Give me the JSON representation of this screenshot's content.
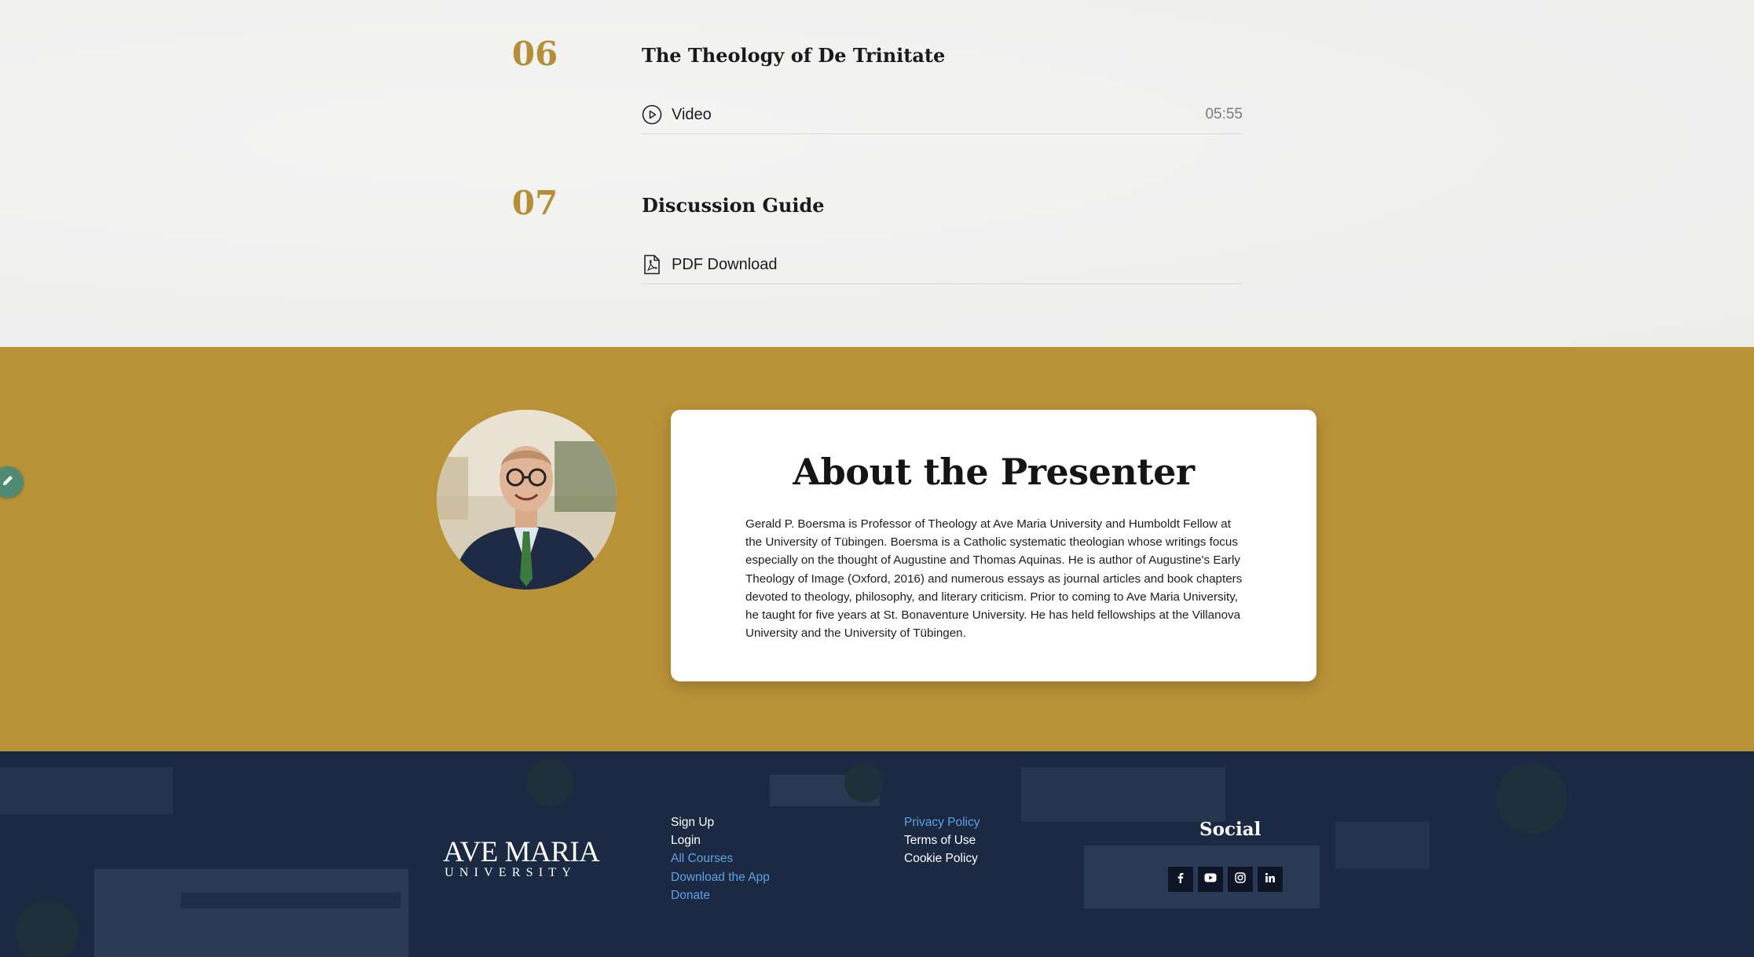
{
  "lessons": [
    {
      "number": "06",
      "title": "The Theology of De Trinitate",
      "item": {
        "icon": "play-circle-icon",
        "label": "Video",
        "duration": "05:55"
      }
    },
    {
      "number": "07",
      "title": "Discussion Guide",
      "item": {
        "icon": "pdf-file-icon",
        "label": "PDF Download",
        "duration": ""
      }
    }
  ],
  "presenter": {
    "heading": "About the Presenter",
    "bio": "Gerald P. Boersma is Professor of Theology at Ave Maria University and Humboldt Fellow at the University of Tübingen. Boersma is a Catholic systematic theologian whose writings focus especially on the thought of Augustine and Thomas Aquinas. He is author of Augustine's Early Theology of Image (Oxford, 2016) and numerous essays as journal articles and book chapters devoted to theology, philosophy, and literary criticism. Prior to coming to Ave Maria University, he taught for five years at St. Bonaventure University. He has held fellowships at the Villanova University and the University of Tübingen.",
    "accent_color": "#b99137"
  },
  "footer": {
    "logo": {
      "main": "AVE MARIA",
      "sub": "UNIVERSITY"
    },
    "links_col1": [
      {
        "label": "Sign Up"
      },
      {
        "label": "Login"
      },
      {
        "label": "All Courses"
      },
      {
        "label": "Download the App"
      },
      {
        "label": "Donate"
      }
    ],
    "links_col2": [
      {
        "label": "Privacy Policy"
      },
      {
        "label": "Terms of Use"
      },
      {
        "label": "Cookie Policy"
      }
    ],
    "social_title": "Social",
    "social_icons": [
      "facebook-icon",
      "youtube-icon",
      "instagram-icon",
      "linkedin-icon"
    ],
    "background_color": "#1b2942",
    "link_color": "#5ea2e8"
  },
  "colors": {
    "number_gold": "#b48f38",
    "edit_button": "#4f8a72"
  }
}
